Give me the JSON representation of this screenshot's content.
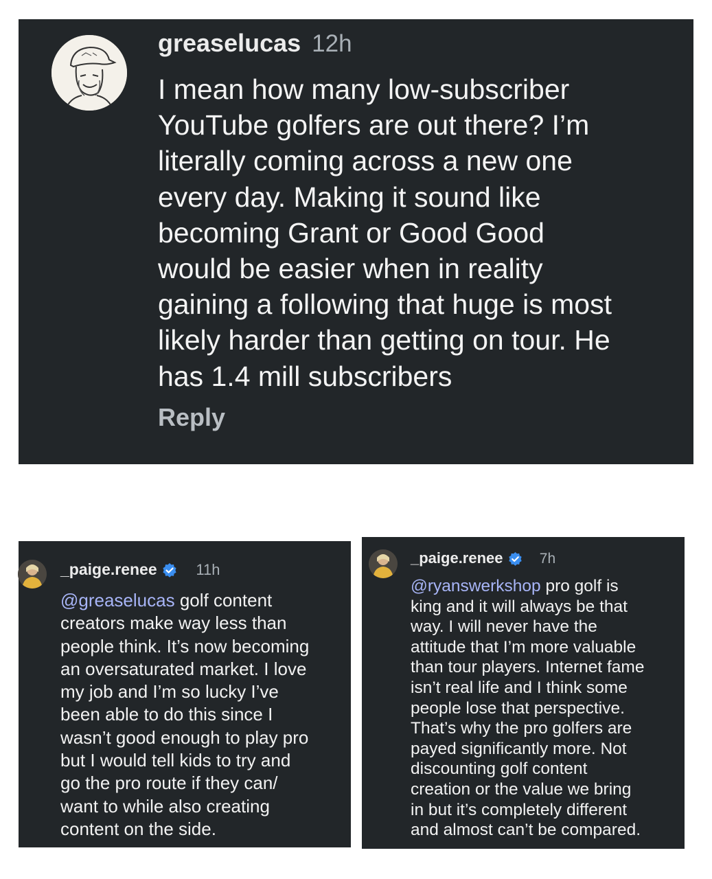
{
  "comment_main": {
    "username": "greaselucas",
    "time": "12h",
    "text": "I mean how many low-subscriber\nYouTube golfers are out there? I’m\nliterally coming across a new one\nevery day. Making it sound like\nbecoming Grant or Good Good\nwould be easier when in reality\ngaining a following that huge is most\nlikely harder than getting on tour. He\nhas 1.4 mill subscribers",
    "reply_label": "Reply",
    "avatar_icon": "sketch-avatar-icon"
  },
  "reply_left": {
    "username": "_paige.renee",
    "time": "11h",
    "verified_icon": "verified-badge-icon",
    "mention": "@greaselucas",
    "text": " golf content\ncreators make way less than\npeople think. It’s now becoming\nan oversaturated market. I love\nmy job and I’m so lucky I’ve\nbeen able to do this since I\nwasn’t good enough to play pro\nbut I would tell kids to try and\ngo the pro route if they can/\nwant to while also creating\ncontent on the side."
  },
  "reply_right": {
    "username": "_paige.renee",
    "time": "7h",
    "verified_icon": "verified-badge-icon",
    "mention": "@ryanswerkshop",
    "text": " pro golf is\nking and it will always be that\nway. I will never have the\nattitude that I’m more valuable\nthan tour players. Internet fame\nisn’t real life and I think some\npeople lose that perspective.\nThat’s why the pro golfers are\npayed significantly more. Not\ndiscounting golf content\ncreation or the value we bring\nin but it’s completely different\nand almost can’t be compared."
  },
  "colors": {
    "panel_bg": "#222629",
    "mention": "#a7b4f6",
    "verified": "#3a8ef0"
  }
}
